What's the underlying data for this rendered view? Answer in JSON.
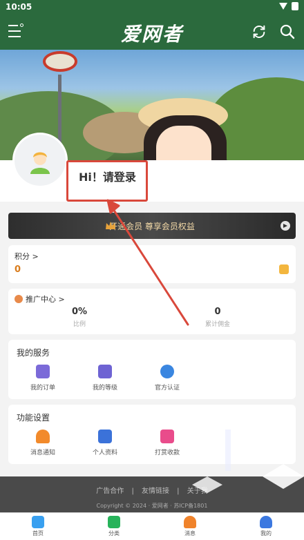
{
  "status_bar": {
    "time": "10:05"
  },
  "app_bar": {
    "title": "爱网者"
  },
  "profile": {
    "login_prompt": "Hi！请登录"
  },
  "vip": {
    "label": "开通会员 尊享会员权益"
  },
  "points": {
    "label": "积分 >",
    "value": "0"
  },
  "promotion": {
    "label": "推广中心 >",
    "stats": [
      {
        "value": "0%",
        "caption": "比例"
      },
      {
        "value": "0",
        "caption": "累计佣金"
      }
    ]
  },
  "services": {
    "title": "我的服务",
    "items": [
      {
        "label": "我的订单",
        "icon": "order-icon",
        "color": "#7b6ad8"
      },
      {
        "label": "我的等级",
        "icon": "level-icon",
        "color": "#6e63d3"
      },
      {
        "label": "官方认证",
        "icon": "verified-icon",
        "color": "#3a86e0"
      }
    ]
  },
  "settings": {
    "title": "功能设置",
    "items": [
      {
        "label": "消息通知",
        "icon": "bell-icon",
        "color": "#f28a2b"
      },
      {
        "label": "个人资料",
        "icon": "profile-icon",
        "color": "#3b72d9"
      },
      {
        "label": "打赏收款",
        "icon": "gift-icon",
        "color": "#e94c8b"
      }
    ]
  },
  "footer": {
    "links": "广告合作 | 友情链接 | 关于我",
    "copyright": "Copyright © 2024 · 爱网者 · 苏ICP备1801"
  },
  "tabs": [
    {
      "label": "首页",
      "icon": "home-icon",
      "color": "#39a0f0"
    },
    {
      "label": "分类",
      "icon": "category-icon",
      "color": "#27b35a"
    },
    {
      "label": "消息",
      "icon": "message-icon",
      "color": "#f0832b"
    },
    {
      "label": "我的",
      "icon": "me-icon",
      "color": "#3b78e0"
    }
  ],
  "colors": {
    "accent": "#2b6a3d",
    "highlight": "#d9483b"
  }
}
